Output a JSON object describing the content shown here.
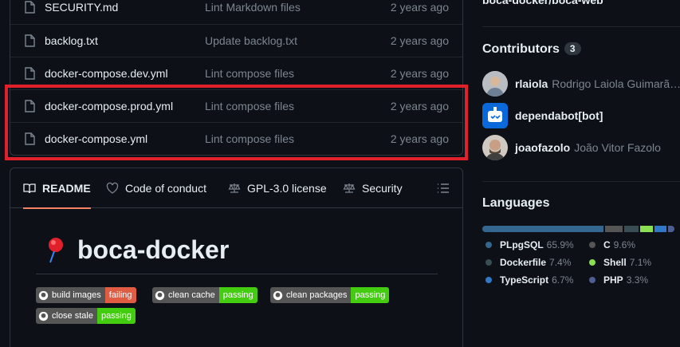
{
  "files": [
    {
      "name": "SECURITY.md",
      "message": "Lint Markdown files",
      "age": "2 years ago"
    },
    {
      "name": "backlog.txt",
      "message": "Update backlog.txt",
      "age": "2 years ago"
    },
    {
      "name": "docker-compose.dev.yml",
      "message": "Lint compose files",
      "age": "2 years ago"
    },
    {
      "name": "docker-compose.prod.yml",
      "message": "Lint compose files",
      "age": "2 years ago"
    },
    {
      "name": "docker-compose.yml",
      "message": "Lint compose files",
      "age": "2 years ago"
    }
  ],
  "readme": {
    "tabs": [
      "README",
      "Code of conduct",
      "GPL-3.0 license",
      "Security"
    ],
    "title": "boca-docker",
    "badges": [
      {
        "label": "build images",
        "status": "failing",
        "color": "#e05d44"
      },
      {
        "label": "clean cache",
        "status": "passing",
        "color": "#44cc11"
      },
      {
        "label": "clean packages",
        "status": "passing",
        "color": "#44cc11"
      },
      {
        "label": "close stale",
        "status": "passing",
        "color": "#44cc11"
      }
    ]
  },
  "sidebar": {
    "top_link": "boca-docker/boca-web",
    "contributors": {
      "heading": "Contributors",
      "count": "3",
      "people": [
        {
          "login": "rlaiola",
          "name": "Rodrigo Laiola Guimarã…"
        },
        {
          "login": "dependabot[bot]",
          "name": ""
        },
        {
          "login": "joaofazolo",
          "name": "João Vitor Fazolo"
        }
      ]
    },
    "languages": {
      "heading": "Languages",
      "items": [
        {
          "name": "PLpgSQL",
          "percent": "65.9%",
          "value": 65.9,
          "color": "#336790"
        },
        {
          "name": "C",
          "percent": "9.6%",
          "value": 9.6,
          "color": "#555555"
        },
        {
          "name": "Dockerfile",
          "percent": "7.4%",
          "value": 7.4,
          "color": "#384d54"
        },
        {
          "name": "Shell",
          "percent": "7.1%",
          "value": 7.1,
          "color": "#89e051"
        },
        {
          "name": "TypeScript",
          "percent": "6.7%",
          "value": 6.7,
          "color": "#3178c6"
        },
        {
          "name": "PHP",
          "percent": "3.3%",
          "value": 3.3,
          "color": "#4F5D95"
        }
      ]
    }
  }
}
